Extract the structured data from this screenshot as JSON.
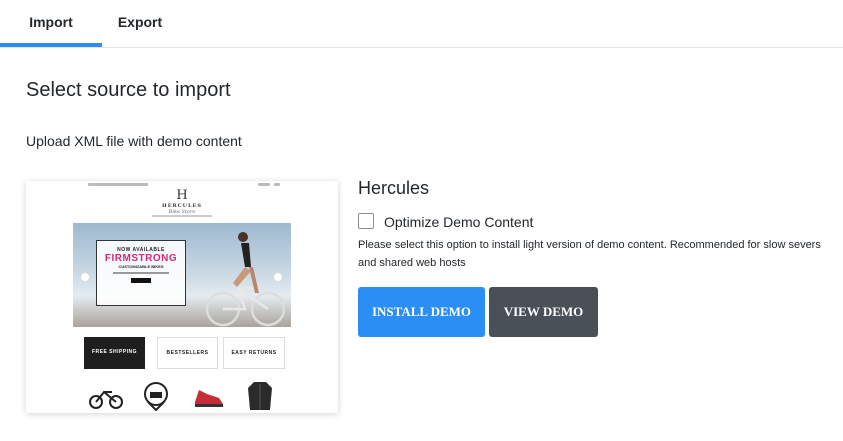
{
  "tabs": [
    {
      "label": "Import",
      "active": true
    },
    {
      "label": "Export",
      "active": false
    }
  ],
  "page": {
    "heading": "Select source to import",
    "subheading": "Upload XML file with demo content"
  },
  "demo": {
    "title": "Hercules",
    "option_label": "Optimize Demo Content",
    "option_checked": false,
    "description": "Please select this option to install light version of demo content. Recommended for slow severs and shared web hosts",
    "install_label": "INSTALL DEMO",
    "view_label": "VIEW DEMO",
    "preview": {
      "logo_letter": "H",
      "logo_name": "HERCULES",
      "logo_script": "Bike Store",
      "hero_line1": "NOW AVAILABLE",
      "hero_line2": "FIRMSTRONG",
      "hero_line3": "CUSTOMIZABLE BIKES",
      "features": [
        {
          "title": "FREE SHIPPING"
        },
        {
          "title": "BESTSELLERS"
        },
        {
          "title": "EASY RETURNS"
        }
      ],
      "products": [
        "bike-icon",
        "helmet-icon",
        "shoe-icon",
        "jacket-icon"
      ]
    }
  },
  "colors": {
    "accent": "#2c8ef3",
    "install_button": "#2b8ef4",
    "view_button": "#4a5058",
    "hero_pink": "#d6287a"
  }
}
